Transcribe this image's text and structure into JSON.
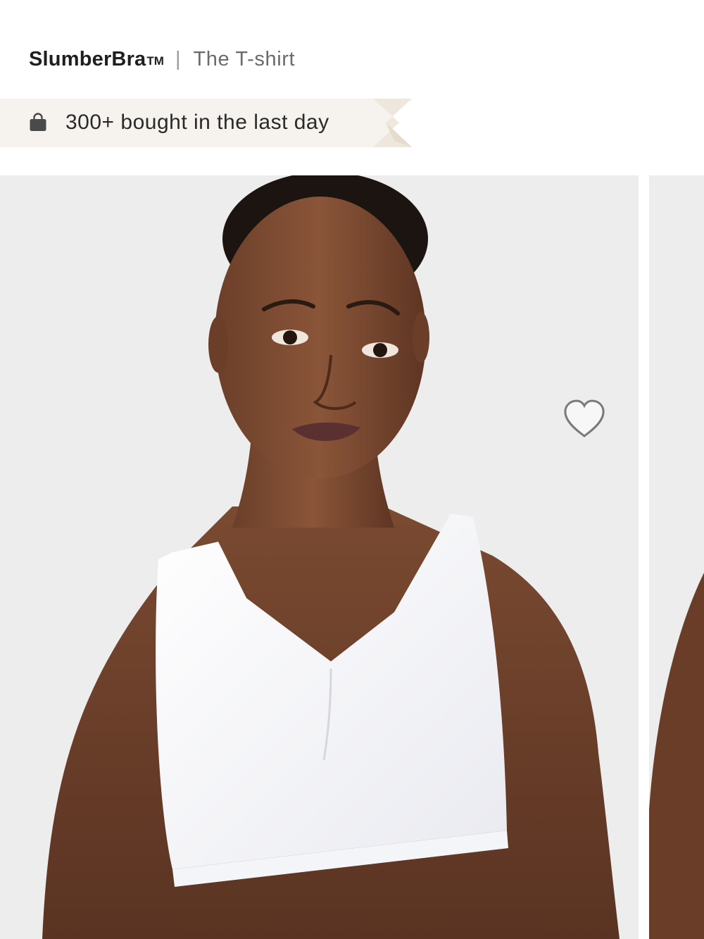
{
  "header": {
    "brand": "SlumberBra",
    "trademark": "TM",
    "separator": "|",
    "subtitle": "The T-shirt"
  },
  "badge": {
    "icon": "shopping-bag-icon",
    "text": "300+ bought in the last day",
    "background_color": "#f6f3ee",
    "accent_color": "#ece5d8"
  },
  "gallery": {
    "favorite_icon": "heart-outline-icon",
    "slide_background": "#ecedec"
  }
}
